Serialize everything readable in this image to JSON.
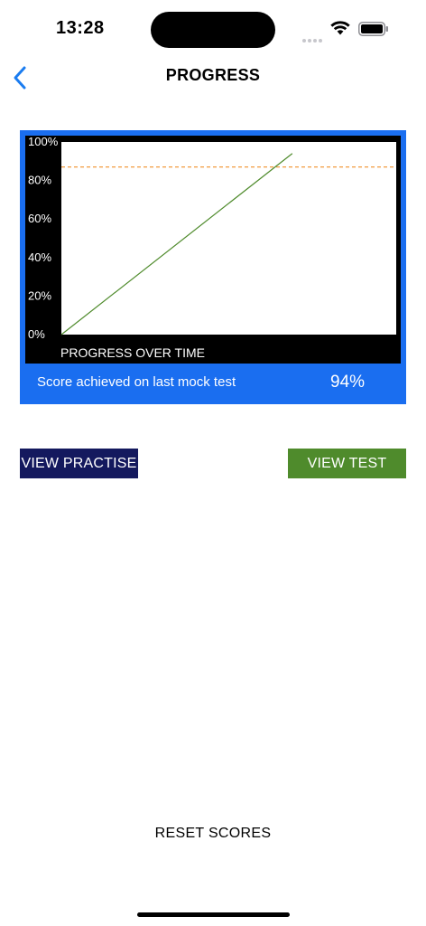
{
  "status": {
    "time": "13:28"
  },
  "nav": {
    "title": "PROGRESS",
    "back_icon": "chevron-left-icon"
  },
  "colors": {
    "card_background": "#1a6ef0",
    "chart_background": "#000000",
    "plot_background": "#ffffff",
    "progress_line": "#4f8b2c",
    "target_line": "#f0902a",
    "practise_button": "#14195e",
    "test_button": "#4f8b2c",
    "back_accent": "#1a7cf0"
  },
  "chart_data": {
    "type": "line",
    "title": "PROGRESS OVER TIME",
    "ylim": [
      0,
      100
    ],
    "y_ticks": [
      "0%",
      "20%",
      "40%",
      "60%",
      "80%",
      "100%"
    ],
    "y_tick_values": [
      0,
      20,
      40,
      60,
      80,
      100
    ],
    "x": [
      1,
      2
    ],
    "xlim": [
      1,
      2.45
    ],
    "series": [
      {
        "values": [
          0,
          94
        ]
      }
    ],
    "reference_line": {
      "y": 87,
      "style": "dashed"
    },
    "grid": false
  },
  "summary": {
    "label": "Score achieved on last mock test",
    "value": "94%"
  },
  "buttons": {
    "practise": "VIEW PRACTISE",
    "test": "VIEW TEST"
  },
  "footer": {
    "reset": "RESET SCORES"
  }
}
